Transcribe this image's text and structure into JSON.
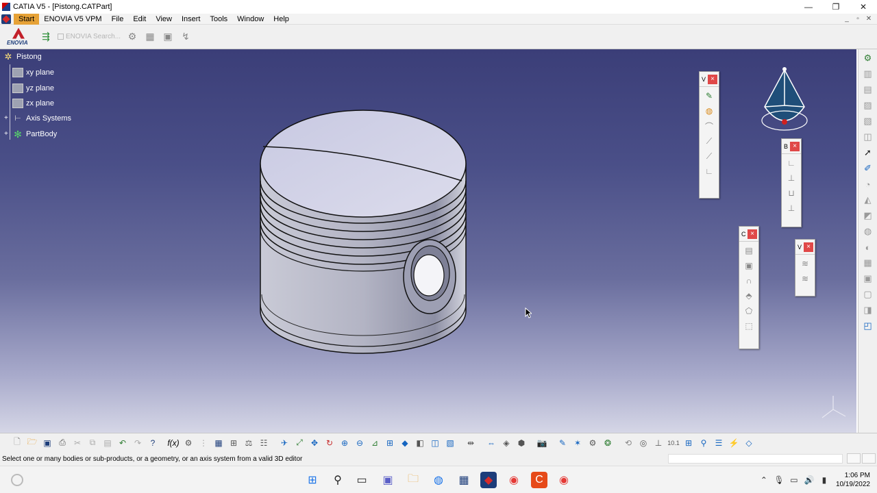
{
  "window": {
    "title": "CATIA V5 - [Pistong.CATPart]",
    "controls": [
      "—",
      "❐",
      "✕"
    ]
  },
  "menubar": {
    "items": [
      "Start",
      "ENOVIA V5 VPM",
      "File",
      "Edit",
      "View",
      "Insert",
      "Tools",
      "Window",
      "Help"
    ],
    "active": "Start",
    "doc_controls": [
      "_",
      "▫",
      "✕"
    ]
  },
  "toolbar_top": {
    "logo_text": "ENOVIA",
    "search_placeholder": "ENOVIA Search..."
  },
  "spec_tree": {
    "root": "Pistong",
    "items": [
      {
        "label": "xy plane",
        "icon": "plane-icon"
      },
      {
        "label": "yz plane",
        "icon": "plane-icon"
      },
      {
        "label": "zx plane",
        "icon": "plane-icon"
      },
      {
        "label": "Axis Systems",
        "icon": "axis-systems-icon"
      },
      {
        "label": "PartBody",
        "icon": "partbody-gear-icon"
      }
    ]
  },
  "palettes": [
    {
      "id": "view-palette",
      "title": "V"
    },
    {
      "id": "bodies-palette",
      "title": "B"
    },
    {
      "id": "constraints-palette",
      "title": "C"
    },
    {
      "id": "view2-palette",
      "title": "V"
    }
  ],
  "statusbar": {
    "message": "Select one or many bodies or sub-products, or a geometry, or an axis system from a valid 3D editor"
  },
  "taskbar": {
    "time": "1:06 PM",
    "date": "10/19/2022"
  },
  "colors": {
    "viewport_top": "#3b3e78",
    "viewport_bottom": "#d5d6e6",
    "tree_text": "#ffffff",
    "active_menu": "#e6a237",
    "palette_close": "#e04848"
  }
}
